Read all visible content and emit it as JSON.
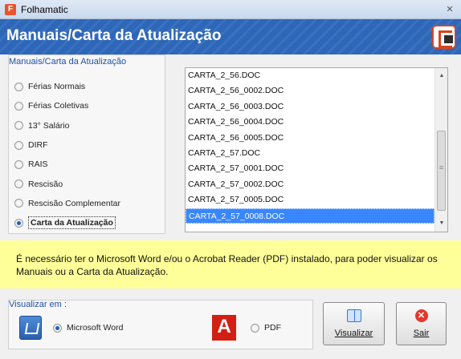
{
  "window": {
    "title": "Folhamatic",
    "close_label": "✕"
  },
  "header": {
    "title": "Manuais/Carta da Atualização"
  },
  "options_group": {
    "legend": "Manuais/Carta da Atualização",
    "selected": "Carta da Atualização",
    "items": [
      {
        "label": "Férias Normais"
      },
      {
        "label": "Férias Coletivas"
      },
      {
        "label": "13° Salário"
      },
      {
        "label": "DIRF"
      },
      {
        "label": "RAIS"
      },
      {
        "label": "Rescisão"
      },
      {
        "label": "Rescisão Complementar"
      },
      {
        "label": "Carta da Atualização"
      }
    ]
  },
  "file_list": {
    "selected": "CARTA_2_57_0008.DOC",
    "items": [
      "CARTA_2_56.DOC",
      "CARTA_2_56_0002.DOC",
      "CARTA_2_56_0003.DOC",
      "CARTA_2_56_0004.DOC",
      "CARTA_2_56_0005.DOC",
      "CARTA_2_57.DOC",
      "CARTA_2_57_0001.DOC",
      "CARTA_2_57_0002.DOC",
      "CARTA_2_57_0005.DOC",
      "CARTA_2_57_0008.DOC"
    ]
  },
  "notice": {
    "text": "É necessário ter o Microsoft Word e/ou o Acrobat Reader (PDF) instalado, para poder visualizar os Manuais ou a Carta da Atualização."
  },
  "view_in": {
    "legend": "Visualizar em :",
    "selected": "Microsoft Word",
    "options": [
      {
        "label": "Microsoft Word",
        "icon": "word-icon"
      },
      {
        "label": "PDF",
        "icon": "acrobat-icon"
      }
    ]
  },
  "buttons": {
    "view_label": "Visualizar",
    "exit_label": "Sair"
  },
  "colors": {
    "header_bg": "#2f67b8",
    "notice_bg": "#ffff99",
    "selection": "#3a86ff",
    "legend_text": "#1f4fa8"
  }
}
